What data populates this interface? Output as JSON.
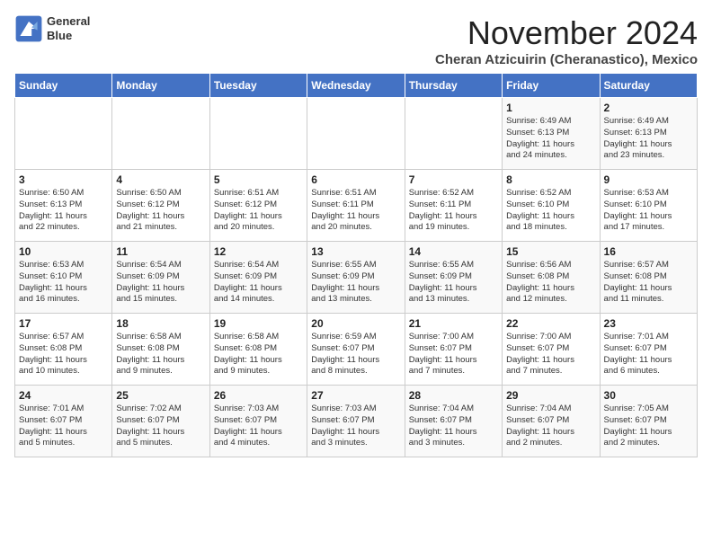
{
  "logo": {
    "line1": "General",
    "line2": "Blue"
  },
  "title": "November 2024",
  "subtitle": "Cheran Atzicuirin (Cheranastico), Mexico",
  "weekdays": [
    "Sunday",
    "Monday",
    "Tuesday",
    "Wednesday",
    "Thursday",
    "Friday",
    "Saturday"
  ],
  "weeks": [
    [
      {
        "day": "",
        "info": ""
      },
      {
        "day": "",
        "info": ""
      },
      {
        "day": "",
        "info": ""
      },
      {
        "day": "",
        "info": ""
      },
      {
        "day": "",
        "info": ""
      },
      {
        "day": "1",
        "info": "Sunrise: 6:49 AM\nSunset: 6:13 PM\nDaylight: 11 hours\nand 24 minutes."
      },
      {
        "day": "2",
        "info": "Sunrise: 6:49 AM\nSunset: 6:13 PM\nDaylight: 11 hours\nand 23 minutes."
      }
    ],
    [
      {
        "day": "3",
        "info": "Sunrise: 6:50 AM\nSunset: 6:13 PM\nDaylight: 11 hours\nand 22 minutes."
      },
      {
        "day": "4",
        "info": "Sunrise: 6:50 AM\nSunset: 6:12 PM\nDaylight: 11 hours\nand 21 minutes."
      },
      {
        "day": "5",
        "info": "Sunrise: 6:51 AM\nSunset: 6:12 PM\nDaylight: 11 hours\nand 20 minutes."
      },
      {
        "day": "6",
        "info": "Sunrise: 6:51 AM\nSunset: 6:11 PM\nDaylight: 11 hours\nand 20 minutes."
      },
      {
        "day": "7",
        "info": "Sunrise: 6:52 AM\nSunset: 6:11 PM\nDaylight: 11 hours\nand 19 minutes."
      },
      {
        "day": "8",
        "info": "Sunrise: 6:52 AM\nSunset: 6:10 PM\nDaylight: 11 hours\nand 18 minutes."
      },
      {
        "day": "9",
        "info": "Sunrise: 6:53 AM\nSunset: 6:10 PM\nDaylight: 11 hours\nand 17 minutes."
      }
    ],
    [
      {
        "day": "10",
        "info": "Sunrise: 6:53 AM\nSunset: 6:10 PM\nDaylight: 11 hours\nand 16 minutes."
      },
      {
        "day": "11",
        "info": "Sunrise: 6:54 AM\nSunset: 6:09 PM\nDaylight: 11 hours\nand 15 minutes."
      },
      {
        "day": "12",
        "info": "Sunrise: 6:54 AM\nSunset: 6:09 PM\nDaylight: 11 hours\nand 14 minutes."
      },
      {
        "day": "13",
        "info": "Sunrise: 6:55 AM\nSunset: 6:09 PM\nDaylight: 11 hours\nand 13 minutes."
      },
      {
        "day": "14",
        "info": "Sunrise: 6:55 AM\nSunset: 6:09 PM\nDaylight: 11 hours\nand 13 minutes."
      },
      {
        "day": "15",
        "info": "Sunrise: 6:56 AM\nSunset: 6:08 PM\nDaylight: 11 hours\nand 12 minutes."
      },
      {
        "day": "16",
        "info": "Sunrise: 6:57 AM\nSunset: 6:08 PM\nDaylight: 11 hours\nand 11 minutes."
      }
    ],
    [
      {
        "day": "17",
        "info": "Sunrise: 6:57 AM\nSunset: 6:08 PM\nDaylight: 11 hours\nand 10 minutes."
      },
      {
        "day": "18",
        "info": "Sunrise: 6:58 AM\nSunset: 6:08 PM\nDaylight: 11 hours\nand 9 minutes."
      },
      {
        "day": "19",
        "info": "Sunrise: 6:58 AM\nSunset: 6:08 PM\nDaylight: 11 hours\nand 9 minutes."
      },
      {
        "day": "20",
        "info": "Sunrise: 6:59 AM\nSunset: 6:07 PM\nDaylight: 11 hours\nand 8 minutes."
      },
      {
        "day": "21",
        "info": "Sunrise: 7:00 AM\nSunset: 6:07 PM\nDaylight: 11 hours\nand 7 minutes."
      },
      {
        "day": "22",
        "info": "Sunrise: 7:00 AM\nSunset: 6:07 PM\nDaylight: 11 hours\nand 7 minutes."
      },
      {
        "day": "23",
        "info": "Sunrise: 7:01 AM\nSunset: 6:07 PM\nDaylight: 11 hours\nand 6 minutes."
      }
    ],
    [
      {
        "day": "24",
        "info": "Sunrise: 7:01 AM\nSunset: 6:07 PM\nDaylight: 11 hours\nand 5 minutes."
      },
      {
        "day": "25",
        "info": "Sunrise: 7:02 AM\nSunset: 6:07 PM\nDaylight: 11 hours\nand 5 minutes."
      },
      {
        "day": "26",
        "info": "Sunrise: 7:03 AM\nSunset: 6:07 PM\nDaylight: 11 hours\nand 4 minutes."
      },
      {
        "day": "27",
        "info": "Sunrise: 7:03 AM\nSunset: 6:07 PM\nDaylight: 11 hours\nand 3 minutes."
      },
      {
        "day": "28",
        "info": "Sunrise: 7:04 AM\nSunset: 6:07 PM\nDaylight: 11 hours\nand 3 minutes."
      },
      {
        "day": "29",
        "info": "Sunrise: 7:04 AM\nSunset: 6:07 PM\nDaylight: 11 hours\nand 2 minutes."
      },
      {
        "day": "30",
        "info": "Sunrise: 7:05 AM\nSunset: 6:07 PM\nDaylight: 11 hours\nand 2 minutes."
      }
    ]
  ]
}
